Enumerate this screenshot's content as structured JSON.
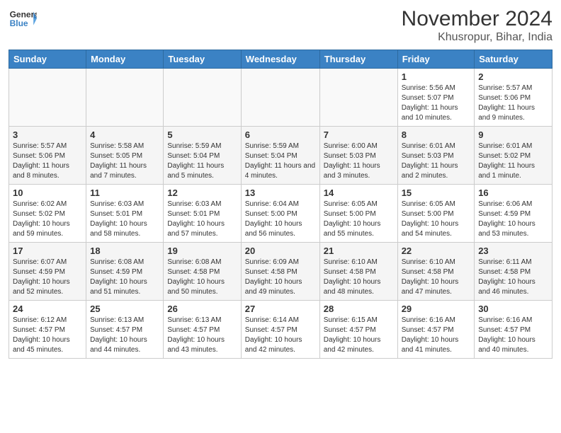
{
  "header": {
    "logo_line1": "General",
    "logo_line2": "Blue",
    "month": "November 2024",
    "location": "Khusropur, Bihar, India"
  },
  "weekdays": [
    "Sunday",
    "Monday",
    "Tuesday",
    "Wednesday",
    "Thursday",
    "Friday",
    "Saturday"
  ],
  "weeks": [
    [
      {
        "day": "",
        "info": ""
      },
      {
        "day": "",
        "info": ""
      },
      {
        "day": "",
        "info": ""
      },
      {
        "day": "",
        "info": ""
      },
      {
        "day": "",
        "info": ""
      },
      {
        "day": "1",
        "info": "Sunrise: 5:56 AM\nSunset: 5:07 PM\nDaylight: 11 hours and 10 minutes."
      },
      {
        "day": "2",
        "info": "Sunrise: 5:57 AM\nSunset: 5:06 PM\nDaylight: 11 hours and 9 minutes."
      }
    ],
    [
      {
        "day": "3",
        "info": "Sunrise: 5:57 AM\nSunset: 5:06 PM\nDaylight: 11 hours and 8 minutes."
      },
      {
        "day": "4",
        "info": "Sunrise: 5:58 AM\nSunset: 5:05 PM\nDaylight: 11 hours and 7 minutes."
      },
      {
        "day": "5",
        "info": "Sunrise: 5:59 AM\nSunset: 5:04 PM\nDaylight: 11 hours and 5 minutes."
      },
      {
        "day": "6",
        "info": "Sunrise: 5:59 AM\nSunset: 5:04 PM\nDaylight: 11 hours and 4 minutes."
      },
      {
        "day": "7",
        "info": "Sunrise: 6:00 AM\nSunset: 5:03 PM\nDaylight: 11 hours and 3 minutes."
      },
      {
        "day": "8",
        "info": "Sunrise: 6:01 AM\nSunset: 5:03 PM\nDaylight: 11 hours and 2 minutes."
      },
      {
        "day": "9",
        "info": "Sunrise: 6:01 AM\nSunset: 5:02 PM\nDaylight: 11 hours and 1 minute."
      }
    ],
    [
      {
        "day": "10",
        "info": "Sunrise: 6:02 AM\nSunset: 5:02 PM\nDaylight: 10 hours and 59 minutes."
      },
      {
        "day": "11",
        "info": "Sunrise: 6:03 AM\nSunset: 5:01 PM\nDaylight: 10 hours and 58 minutes."
      },
      {
        "day": "12",
        "info": "Sunrise: 6:03 AM\nSunset: 5:01 PM\nDaylight: 10 hours and 57 minutes."
      },
      {
        "day": "13",
        "info": "Sunrise: 6:04 AM\nSunset: 5:00 PM\nDaylight: 10 hours and 56 minutes."
      },
      {
        "day": "14",
        "info": "Sunrise: 6:05 AM\nSunset: 5:00 PM\nDaylight: 10 hours and 55 minutes."
      },
      {
        "day": "15",
        "info": "Sunrise: 6:05 AM\nSunset: 5:00 PM\nDaylight: 10 hours and 54 minutes."
      },
      {
        "day": "16",
        "info": "Sunrise: 6:06 AM\nSunset: 4:59 PM\nDaylight: 10 hours and 53 minutes."
      }
    ],
    [
      {
        "day": "17",
        "info": "Sunrise: 6:07 AM\nSunset: 4:59 PM\nDaylight: 10 hours and 52 minutes."
      },
      {
        "day": "18",
        "info": "Sunrise: 6:08 AM\nSunset: 4:59 PM\nDaylight: 10 hours and 51 minutes."
      },
      {
        "day": "19",
        "info": "Sunrise: 6:08 AM\nSunset: 4:58 PM\nDaylight: 10 hours and 50 minutes."
      },
      {
        "day": "20",
        "info": "Sunrise: 6:09 AM\nSunset: 4:58 PM\nDaylight: 10 hours and 49 minutes."
      },
      {
        "day": "21",
        "info": "Sunrise: 6:10 AM\nSunset: 4:58 PM\nDaylight: 10 hours and 48 minutes."
      },
      {
        "day": "22",
        "info": "Sunrise: 6:10 AM\nSunset: 4:58 PM\nDaylight: 10 hours and 47 minutes."
      },
      {
        "day": "23",
        "info": "Sunrise: 6:11 AM\nSunset: 4:58 PM\nDaylight: 10 hours and 46 minutes."
      }
    ],
    [
      {
        "day": "24",
        "info": "Sunrise: 6:12 AM\nSunset: 4:57 PM\nDaylight: 10 hours and 45 minutes."
      },
      {
        "day": "25",
        "info": "Sunrise: 6:13 AM\nSunset: 4:57 PM\nDaylight: 10 hours and 44 minutes."
      },
      {
        "day": "26",
        "info": "Sunrise: 6:13 AM\nSunset: 4:57 PM\nDaylight: 10 hours and 43 minutes."
      },
      {
        "day": "27",
        "info": "Sunrise: 6:14 AM\nSunset: 4:57 PM\nDaylight: 10 hours and 42 minutes."
      },
      {
        "day": "28",
        "info": "Sunrise: 6:15 AM\nSunset: 4:57 PM\nDaylight: 10 hours and 42 minutes."
      },
      {
        "day": "29",
        "info": "Sunrise: 6:16 AM\nSunset: 4:57 PM\nDaylight: 10 hours and 41 minutes."
      },
      {
        "day": "30",
        "info": "Sunrise: 6:16 AM\nSunset: 4:57 PM\nDaylight: 10 hours and 40 minutes."
      }
    ]
  ]
}
